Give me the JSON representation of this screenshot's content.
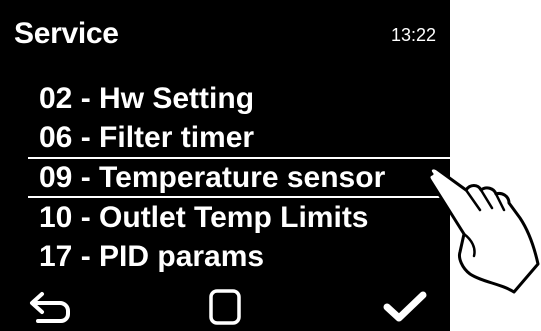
{
  "header": {
    "title": "Service",
    "clock": "13:22"
  },
  "menu": {
    "items": [
      {
        "label": "02 - Hw Setting",
        "selected": false
      },
      {
        "label": "06 - Filter timer",
        "selected": false
      },
      {
        "label": "09 - Temperature sensor",
        "selected": true
      },
      {
        "label": "10 - Outlet Temp Limits",
        "selected": false
      },
      {
        "label": "17 - PID params",
        "selected": false
      }
    ]
  },
  "bottom_bar": {
    "icons": [
      "back-arrow-icon",
      "square-icon",
      "checkmark-icon"
    ]
  },
  "colors": {
    "screen_background": "#000000",
    "text": "#ffffff",
    "outside_background": "#ffffff"
  }
}
